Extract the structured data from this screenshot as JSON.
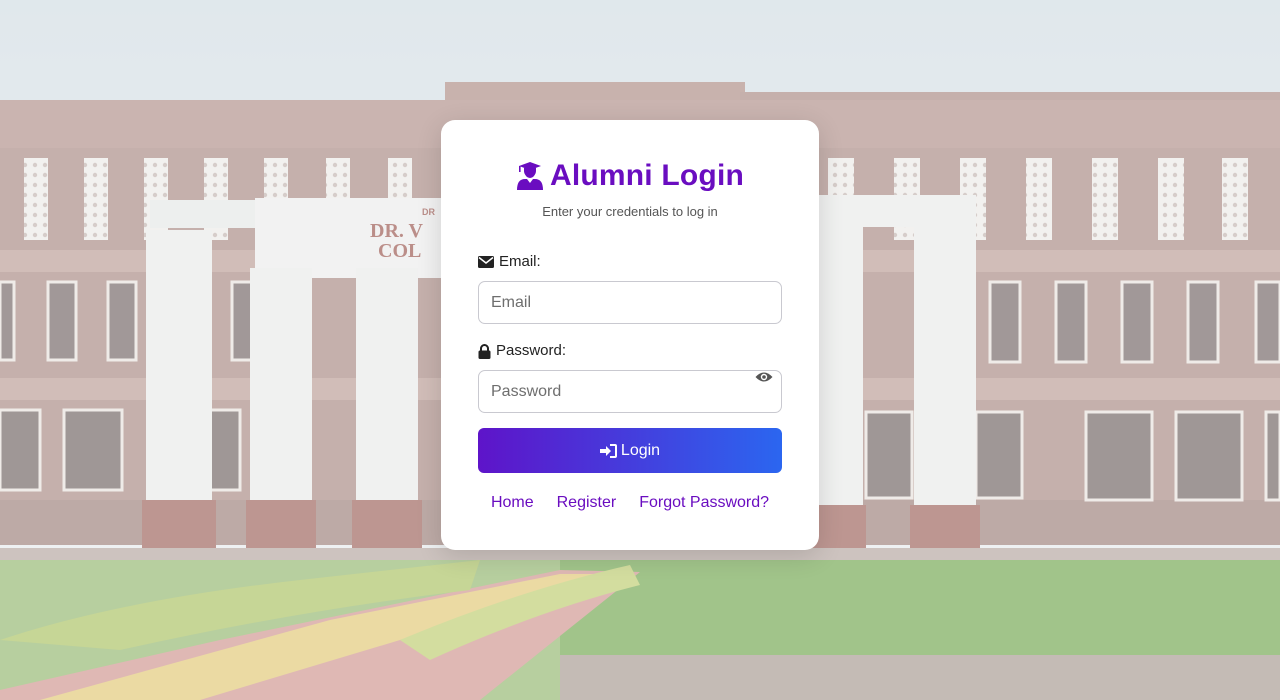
{
  "login_card": {
    "title": "Alumni Login",
    "title_icon": "graduate-icon",
    "subtitle": "Enter your credentials to log in",
    "email": {
      "label": "Email:",
      "icon": "envelope-icon",
      "placeholder": "Email",
      "value": ""
    },
    "password": {
      "label": "Password:",
      "icon": "lock-icon",
      "placeholder": "Password",
      "value": "",
      "toggle_icon": "eye-icon"
    },
    "login_button": {
      "label": "Login",
      "icon": "sign-in-icon"
    },
    "links": [
      {
        "label": "Home"
      },
      {
        "label": "Register"
      },
      {
        "label": "Forgot Password?"
      }
    ]
  },
  "background": {
    "building_sign": [
      "DR",
      "DR. V",
      "COL"
    ]
  },
  "colors": {
    "accent": "#6a0dc0",
    "button_gradient_start": "#5e14c9",
    "button_gradient_end": "#2b66f0",
    "card_background": "#ffffff"
  }
}
